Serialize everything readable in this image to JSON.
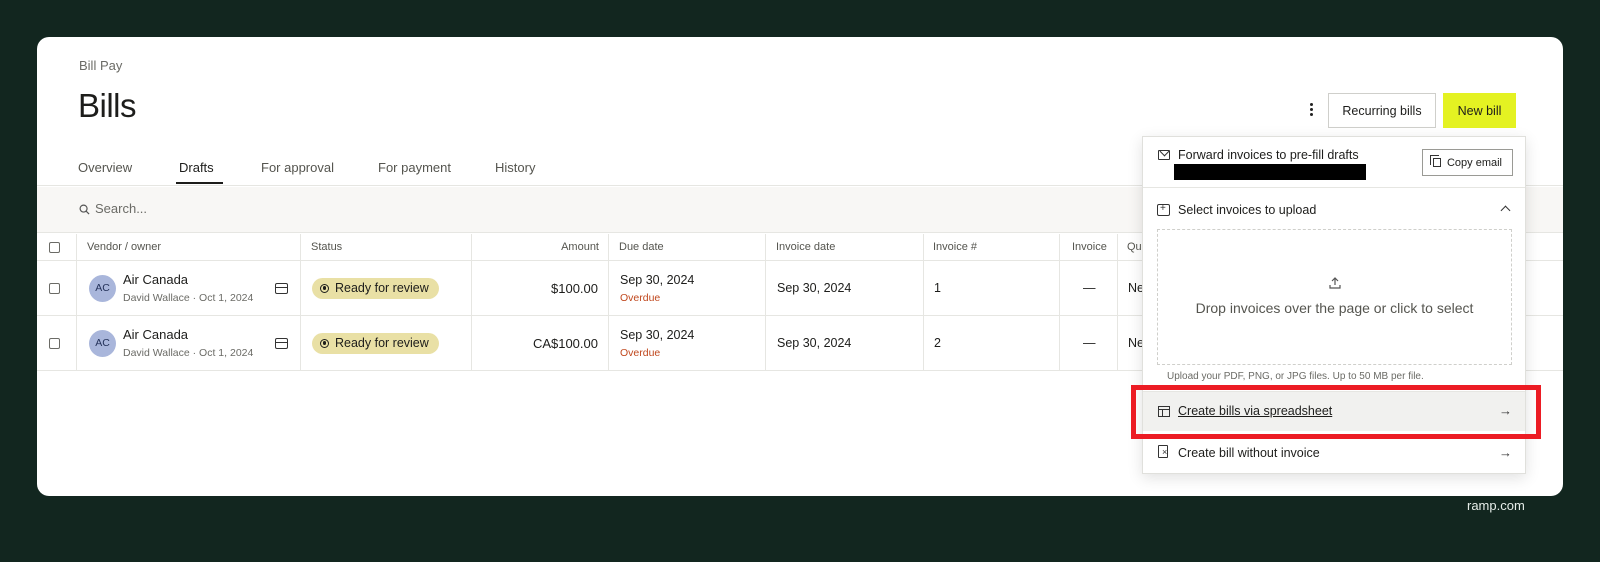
{
  "header": {
    "breadcrumb": "Bill Pay",
    "title": "Bills",
    "more_icon": "kebab-icon",
    "recurring_label": "Recurring bills",
    "new_label": "New bill",
    "accent": "#e4f222"
  },
  "tabs": [
    {
      "label": "Overview"
    },
    {
      "label": "Drafts",
      "active": true
    },
    {
      "label": "For approval"
    },
    {
      "label": "For payment"
    },
    {
      "label": "History"
    }
  ],
  "search": {
    "placeholder": "Search..."
  },
  "table": {
    "columns": [
      "Vendor / owner",
      "Status",
      "Amount",
      "Due date",
      "Invoice date",
      "Invoice #",
      "Invoice",
      "Qui"
    ],
    "rows": [
      {
        "initials": "AC",
        "vendor": "Air Canada",
        "owner": "David Wallace · Oct 1, 2024",
        "status": "Ready for review",
        "amount": "$100.00",
        "due_date": "Sep 30, 2024",
        "due_note": "Overdue",
        "invoice_date": "Sep 30, 2024",
        "invoice_num": "1",
        "invoice": "—",
        "extra": "Ne"
      },
      {
        "initials": "AC",
        "vendor": "Air Canada",
        "owner": "David Wallace · Oct 1, 2024",
        "status": "Ready for review",
        "amount": "CA$100.00",
        "due_date": "Sep 30, 2024",
        "due_note": "Overdue",
        "invoice_date": "Sep 30, 2024",
        "invoice_num": "2",
        "invoice": "—",
        "extra": "Ne"
      }
    ]
  },
  "panel": {
    "forward_label": "Forward invoices to pre-fill drafts",
    "copy_label": "Copy email",
    "select_label": "Select invoices to upload",
    "drop_text": "Drop invoices over the page or click to select",
    "upload_hint": "Upload your PDF, PNG, or JPG files. Up to 50 MB per file.",
    "spreadsheet_label": "Create bills via spreadsheet",
    "without_label": "Create bill without invoice",
    "arrow": "→"
  },
  "colors": {
    "overdue": "#c0481e",
    "status_badge": "#e9e0a5",
    "highlight": "#ec1c24",
    "background": "#12261f"
  },
  "watermark": "ramp.com"
}
